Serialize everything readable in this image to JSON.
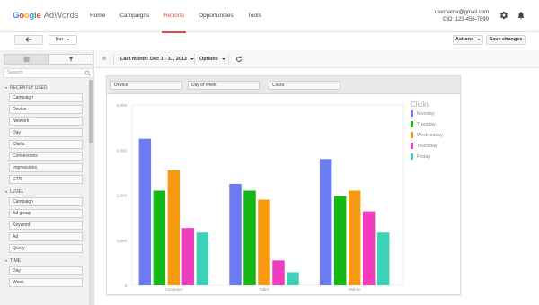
{
  "app": {
    "logo_google": "Google",
    "logo_product": "AdWords"
  },
  "nav": [
    {
      "label": "Home",
      "active": false
    },
    {
      "label": "Campaigns",
      "active": false
    },
    {
      "label": "Reports",
      "active": true
    },
    {
      "label": "Opportunities",
      "active": false
    },
    {
      "label": "Tools",
      "active": false
    }
  ],
  "account": {
    "email": "username@gmail.com",
    "cid": "CID: 123-456-7890"
  },
  "toolbar": {
    "back_icon": "arrow-left-icon",
    "chart_type": "Bar",
    "actions_label": "Actions",
    "save_label": "Save changes"
  },
  "left_panel": {
    "search_placeholder": "Search",
    "groups": [
      {
        "label": "RECENTLY USED",
        "items": [
          "Campaign",
          "Device",
          "Network",
          "Day",
          "Clicks",
          "Conversions",
          "Impressions",
          "CTR"
        ]
      },
      {
        "label": "LEVEL",
        "items": [
          "Campaign",
          "Ad group",
          "Keyword",
          "Ad",
          "Query"
        ]
      },
      {
        "label": "TIME",
        "items": [
          "Day",
          "Week"
        ]
      }
    ]
  },
  "report_bar": {
    "collapse": "«",
    "date_prefix": "Last month:",
    "date_range": "Dec 1 - 31, 2013",
    "options_label": "Options"
  },
  "fields": {
    "row": "Device",
    "column": "Day of week",
    "metric": "Clicks"
  },
  "colors": {
    "accent": "#dd4b39",
    "monday": "#6c7cf0",
    "tuesday": "#14b814",
    "wednesday": "#f79a12",
    "thursday": "#f03cbf",
    "friday": "#3ed1b8"
  },
  "chart_data": {
    "type": "bar",
    "categories": [
      "Computer",
      "Tablet",
      "Mobile"
    ],
    "series": [
      {
        "name": "Monday",
        "values": [
          3250,
          2250,
          2800
        ]
      },
      {
        "name": "Tuesday",
        "values": [
          2100,
          2100,
          1980
        ]
      },
      {
        "name": "Wednesday",
        "values": [
          2550,
          1900,
          2100
        ]
      },
      {
        "name": "Thursday",
        "values": [
          1270,
          550,
          1640
        ]
      },
      {
        "name": "Friday",
        "values": [
          1170,
          290,
          1170
        ]
      }
    ],
    "legend_title": "Clicks",
    "yticks": [
      "0",
      "1,000",
      "2,000",
      "3,000",
      "4,000"
    ],
    "ylim": [
      0,
      4000
    ],
    "legend_position": "right",
    "grid": false
  }
}
